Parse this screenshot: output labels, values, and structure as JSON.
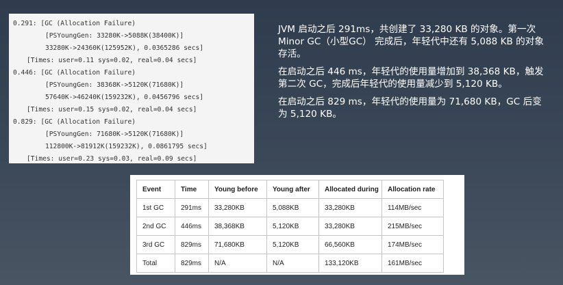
{
  "log": {
    "lines": [
      "0.291: [GC (Allocation Failure)",
      "[PSYoungGen: 33280K->5088K(38400K)]",
      "33280K->24360K(125952K), 0.0365286 secs]",
      "[Times: user=0.11 sys=0.02, real=0.04 secs]",
      "0.446: [GC (Allocation Failure)",
      "[PSYoungGen: 38368K->5120K(71680K)]",
      "57640K->46240K(159232K), 0.0456796 secs]",
      "[Times: user=0.15 sys=0.02, real=0.04 secs]",
      "0.829: [GC (Allocation Failure)",
      "[PSYoungGen: 71680K->5120K(71680K)]",
      "112800K->81912K(159232K), 0.0861795 secs]",
      "[Times: user=0.23 sys=0.03, real=0.09 secs]"
    ]
  },
  "notes": {
    "p1": "JVM 启动之后 291ms，共创建了 33,280 KB 的对象。第一次 Minor GC（小型GC） 完成后，年轻代中还有 5,088 KB 的对象存活。",
    "p2": "在启动之后 446 ms，年轻代的使用量增加到 38,368 KB，触发第二次 GC，完成后年轻代的使用量减少到 5,120 KB。",
    "p3": "在启动之后 829 ms，年轻代的使用量为 71,680 KB，GC 后变为 5,120 KB。"
  },
  "table": {
    "headers": [
      "Event",
      "Time",
      "Young before",
      "Young after",
      "Allocated during",
      "Allocation rate"
    ],
    "rows": [
      [
        "1st GC",
        "291ms",
        "33,280KB",
        "5,088KB",
        "33,280KB",
        "114MB/sec"
      ],
      [
        "2nd GC",
        "446ms",
        "38,368KB",
        "5,120KB",
        "33,280KB",
        "215MB/sec"
      ],
      [
        "3rd GC",
        "829ms",
        "71,680KB",
        "5,120KB",
        "66,560KB",
        "174MB/sec"
      ],
      [
        "Total",
        "829ms",
        "N/A",
        "N/A",
        "133,120KB",
        "161MB/sec"
      ]
    ]
  }
}
